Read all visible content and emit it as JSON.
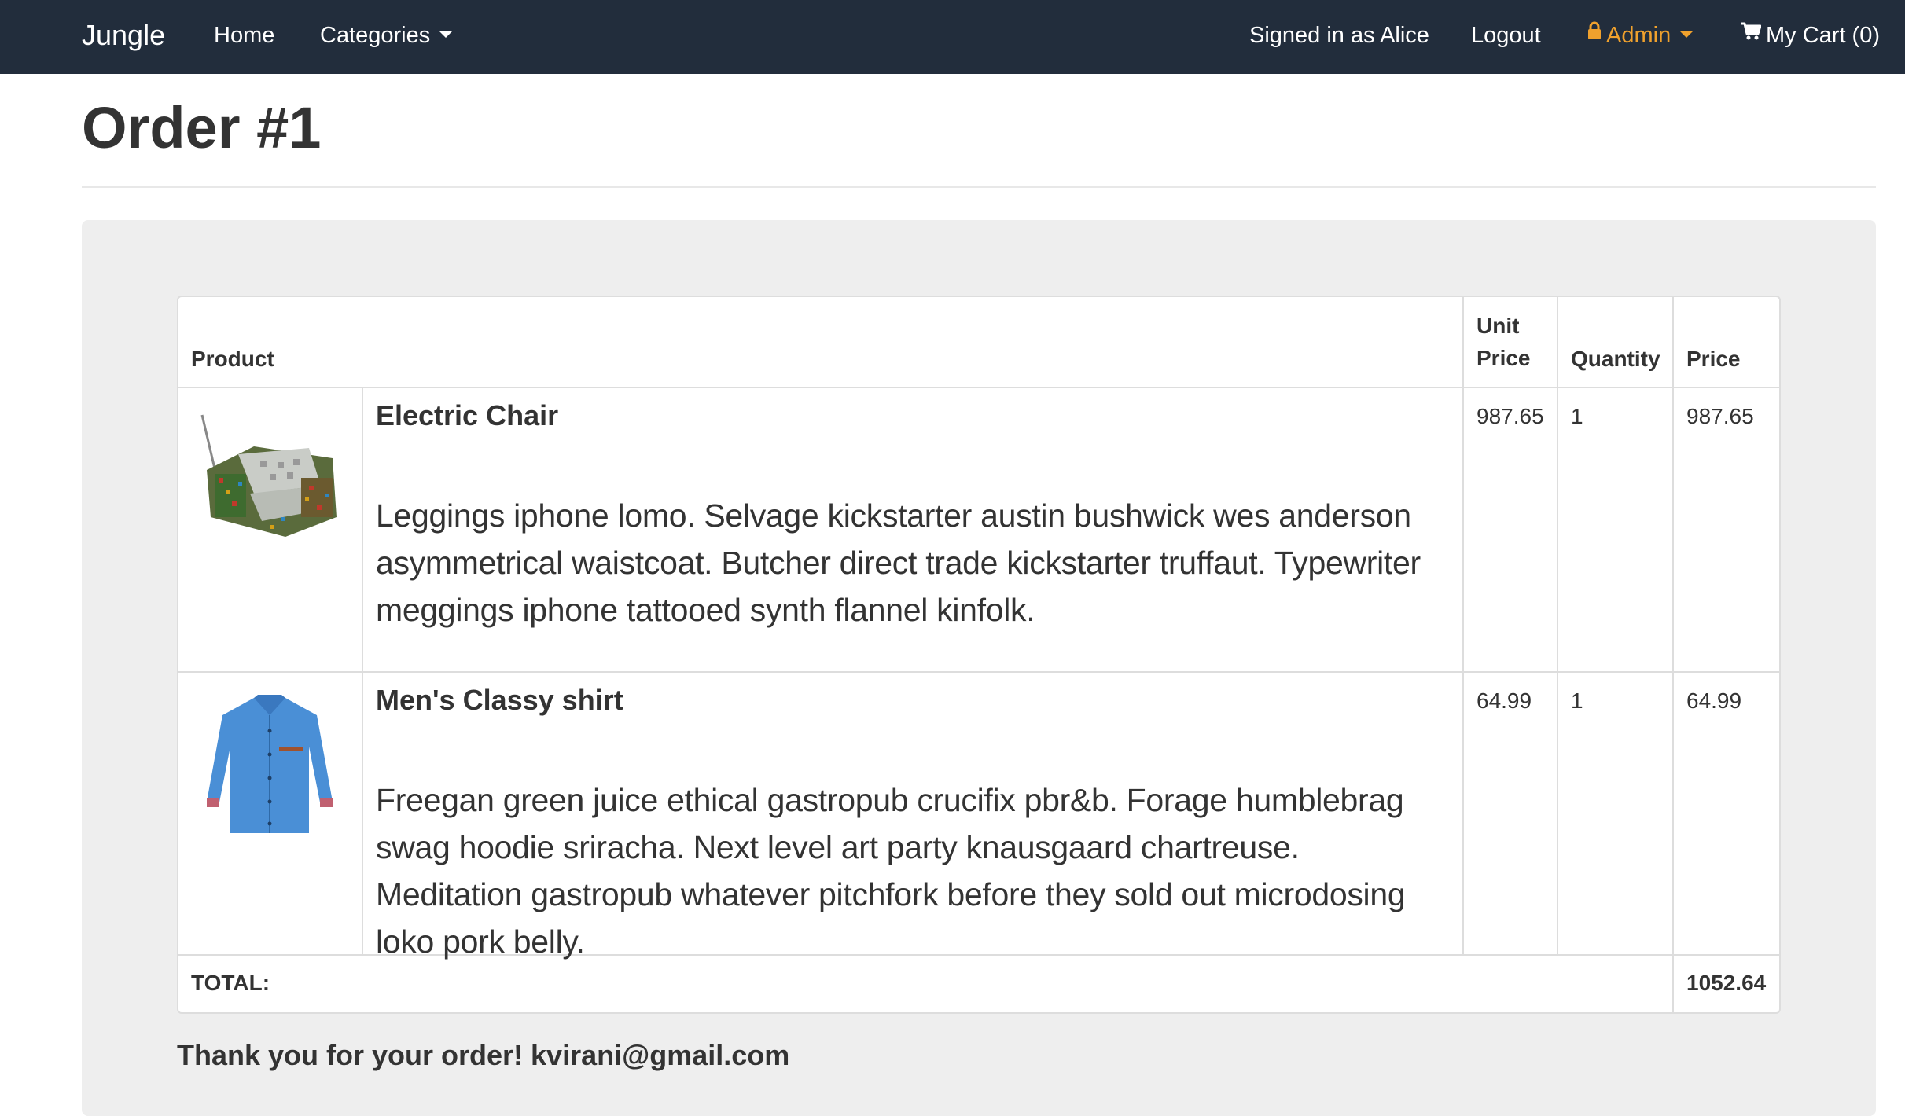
{
  "nav": {
    "brand": "Jungle",
    "home": "Home",
    "categories": "Categories",
    "signed_in": "Signed in as Alice",
    "logout": "Logout",
    "admin": "Admin",
    "cart": "My Cart (0)"
  },
  "page": {
    "title": "Order #1"
  },
  "table": {
    "headers": {
      "product": "Product",
      "unit_price": [
        "Unit",
        "Price"
      ],
      "quantity": "Quantity",
      "price": "Price"
    },
    "rows": [
      {
        "image_icon": "armchair-image",
        "name": "Electric Chair",
        "description": "Leggings iphone lomo. Selvage kickstarter austin bushwick wes anderson asymmetrical waistcoat. Butcher direct trade kickstarter truffaut. Typewriter meggings iphone tattooed synth flannel kinfolk.",
        "unit_price": "987.65",
        "quantity": "1",
        "price": "987.65"
      },
      {
        "image_icon": "shirt-image",
        "name": "Men's Classy shirt",
        "description": "Freegan green juice ethical gastropub crucifix pbr&b. Forage humblebrag swag hoodie sriracha. Next level art party knausgaard chartreuse. Meditation gastropub whatever pitchfork before they sold out microdosing loko pork belly.",
        "unit_price": "64.99",
        "quantity": "1",
        "price": "64.99"
      }
    ],
    "total_label": "TOTAL:",
    "total_value": "1052.64"
  },
  "thanks": "Thank you for your order! kvirani@gmail.com",
  "colors": {
    "navbar_bg": "#222d3c",
    "admin_accent": "#f0a12d",
    "well_bg": "#eeeeee",
    "border": "#dddddd"
  }
}
